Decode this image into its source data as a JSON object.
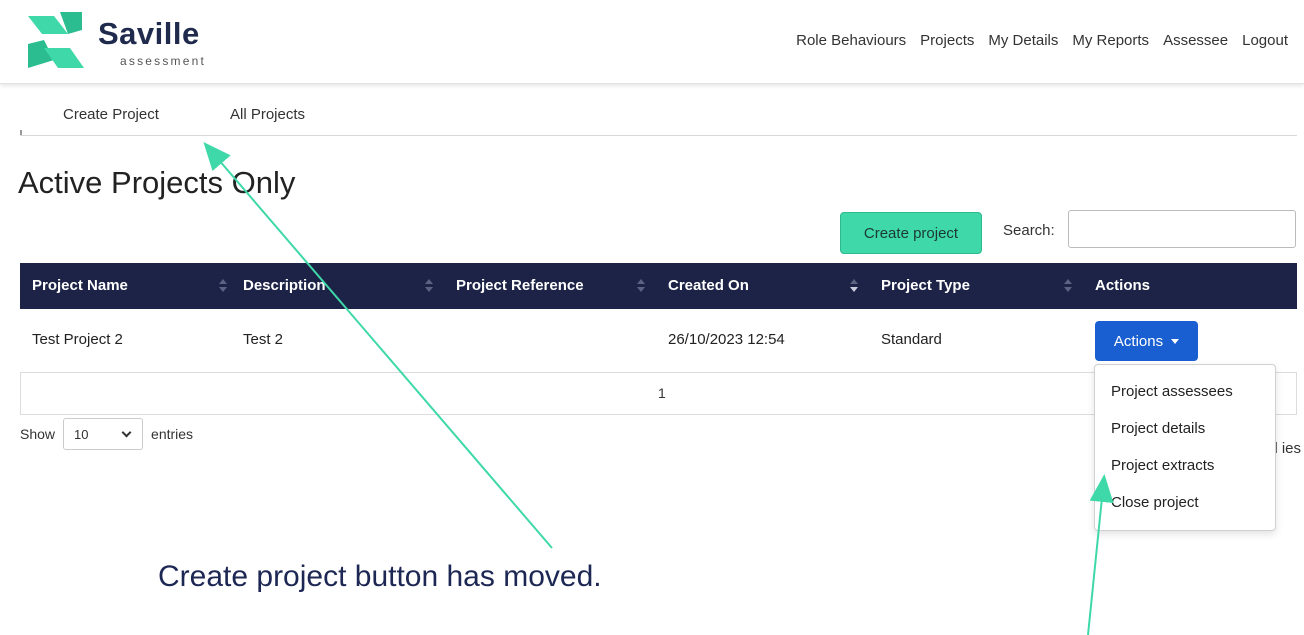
{
  "brand": {
    "name": "Saville",
    "tagline": "assessment",
    "colors": {
      "navy": "#1c2347",
      "teal": "#3fd8a8",
      "blue": "#1a5fd1"
    }
  },
  "top_nav": [
    "Role Behaviours",
    "Projects",
    "My Details",
    "My Reports",
    "Assessee",
    "Logout"
  ],
  "sub_nav": [
    "Create Project",
    "All Projects"
  ],
  "page_title": "Active Projects Only",
  "toolbar": {
    "create_label": "Create project",
    "search_label": "Search:",
    "search_value": ""
  },
  "table": {
    "columns": [
      "Project Name",
      "Description",
      "Project Reference",
      "Created On",
      "Project Type",
      "Actions"
    ],
    "rows": [
      {
        "name": "Test Project 2",
        "description": "Test 2",
        "reference": "",
        "created": "26/10/2023 12:54",
        "type": "Standard",
        "action_label": "Actions"
      }
    ]
  },
  "pagination": {
    "current_page": "1"
  },
  "length_menu": {
    "prefix": "Show",
    "value": "10",
    "suffix": "entries"
  },
  "info_partial": "Sl ies",
  "actions_menu": [
    "Project assessees",
    "Project details",
    "Project extracts",
    "Close project"
  ],
  "annotation": {
    "text": "Create project button has moved."
  },
  "icons": [
    "saville-logo-icon",
    "sort-icon",
    "caret-down-icon",
    "chevron-down-icon"
  ]
}
